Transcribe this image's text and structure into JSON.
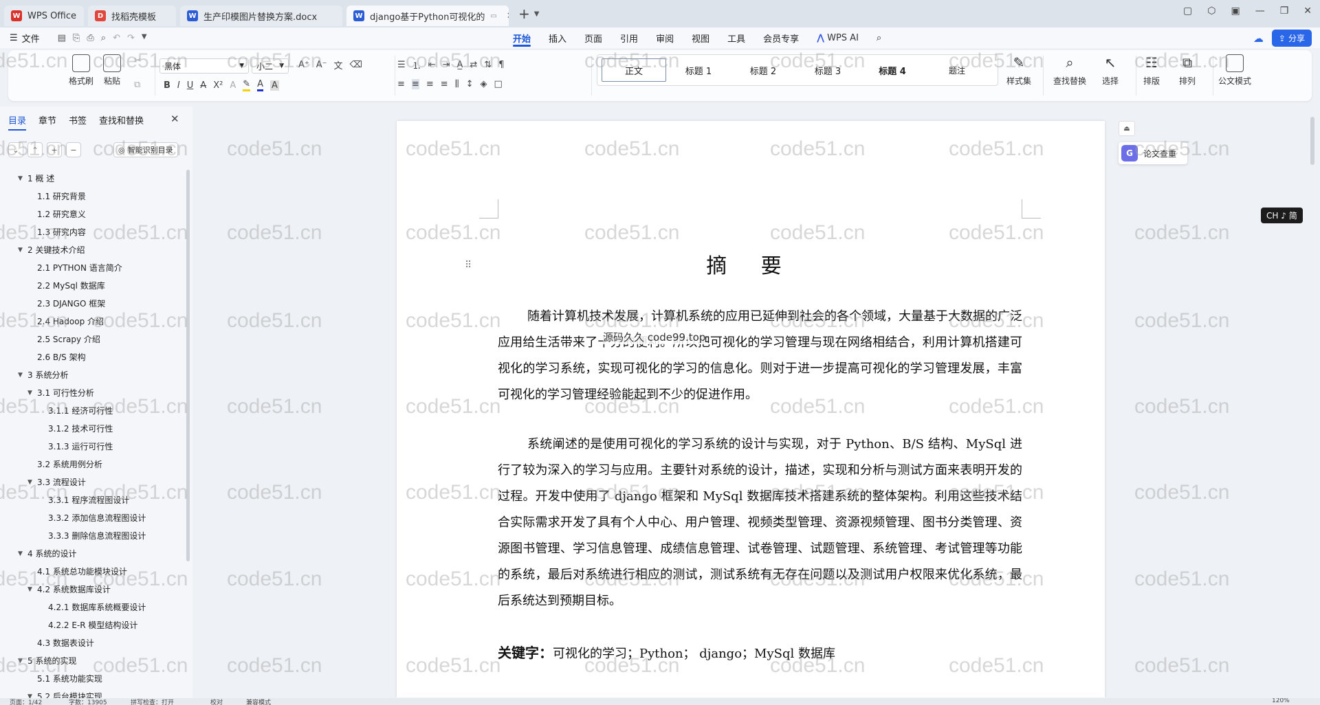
{
  "tabs": [
    {
      "label": "WPS Office",
      "icon": "wps-logo",
      "color": "#d9312a"
    },
    {
      "label": "找稻壳模板",
      "icon": "template-icon",
      "color": "#e0463a"
    },
    {
      "label": "生产印模图片替换方案.docx",
      "icon": "word-doc-icon",
      "color": "#2b5cd6"
    },
    {
      "label": "django基于Python可视化的",
      "icon": "word-doc-icon",
      "color": "#2b5cd6",
      "active": true
    }
  ],
  "menu": {
    "file": "文件",
    "tabs": [
      "开始",
      "插入",
      "页面",
      "引用",
      "审阅",
      "视图",
      "工具",
      "会员专享"
    ],
    "active_tab": "开始",
    "wps_ai": "WPS AI",
    "share": "分享"
  },
  "ribbon": {
    "format_painter": "格式刷",
    "paste": "粘贴",
    "font_name": "黑体",
    "font_size": "小二",
    "styles": [
      "正文",
      "标题 1",
      "标题 2",
      "标题 3",
      "标题 4",
      "题注"
    ],
    "style_set": "样式集",
    "find_replace": "查找替换",
    "select": "选择",
    "layout": "排版",
    "arrange": "排列",
    "official_mode": "公文模式"
  },
  "nav": {
    "tabs": [
      "目录",
      "章节",
      "书签",
      "查找和替换"
    ],
    "active_tab": "目录",
    "smart_btn": "智能识别目录",
    "toc": [
      {
        "level": 0,
        "text": "1   概    述",
        "expand": true
      },
      {
        "level": 1,
        "text": "1.1  研究背景"
      },
      {
        "level": 1,
        "text": "1.2  研究意义"
      },
      {
        "level": 1,
        "text": "1.3  研究内容"
      },
      {
        "level": 0,
        "text": "2   关键技术介绍",
        "expand": true
      },
      {
        "level": 1,
        "text": "2.1 PYTHON 语言简介"
      },
      {
        "level": 1,
        "text": "2.2 MySql 数据库"
      },
      {
        "level": 1,
        "text": "2.3 DJANGO 框架"
      },
      {
        "level": 1,
        "text": "2.4 Hadoop 介绍"
      },
      {
        "level": 1,
        "text": "2.5 Scrapy 介绍"
      },
      {
        "level": 1,
        "text": "2.6 B/S 架构"
      },
      {
        "level": 0,
        "text": "3   系统分析",
        "expand": true
      },
      {
        "level": 1,
        "text": "3.1   可行性分析",
        "expand": true
      },
      {
        "level": 2,
        "text": "3.1.1 经济可行性"
      },
      {
        "level": 2,
        "text": "3.1.2 技术可行性"
      },
      {
        "level": 2,
        "text": "3.1.3 运行可行性"
      },
      {
        "level": 1,
        "text": "3.2 系统用例分析"
      },
      {
        "level": 1,
        "text": "3.3 流程设计",
        "expand": true
      },
      {
        "level": 2,
        "text": "3.3.1 程序流程图设计"
      },
      {
        "level": 2,
        "text": "3.3.2 添加信息流程图设计"
      },
      {
        "level": 2,
        "text": "3.3.3 删除信息流程图设计"
      },
      {
        "level": 0,
        "text": "4   系统的设计",
        "expand": true
      },
      {
        "level": 1,
        "text": "4.1  系统总功能模块设计"
      },
      {
        "level": 1,
        "text": "4.2  系统数据库设计",
        "expand": true
      },
      {
        "level": 2,
        "text": "4.2.1  数据库系统概要设计"
      },
      {
        "level": 2,
        "text": "4.2.2 E-R 模型结构设计"
      },
      {
        "level": 1,
        "text": "4.3 数据表设计"
      },
      {
        "level": 0,
        "text": "5   系统的实现",
        "expand": true
      },
      {
        "level": 1,
        "text": "5.1 系统功能实现"
      },
      {
        "level": 1,
        "text": "5.2 后台模块实现",
        "expand": true
      }
    ]
  },
  "doc": {
    "title": "摘 要",
    "para1": "随着计算机技术发展，计算机系统的应用已延伸到社会的各个领域，大量基于大数据的广泛应用给生活带来了十分的便利。所以把可视化的学习管理与现在网络相结合，利用计算机搭建可视化的学习系统，实现可视化的学习的信息化。则对于进一步提高可视化的学习管理发展，丰富可视化的学习管理经验能起到不少的促进作用。",
    "para2": "系统阐述的是使用可视化的学习系统的设计与实现，对于 Python、B/S 结构、MySql 进行了较为深入的学习与应用。主要针对系统的设计，描述，实现和分析与测试方面来表明开发的过程。开发中使用了 django 框架和 MySql 数据库技术搭建系统的整体架构。利用这些技术结合实际需求开发了具有个人中心、用户管理、视频类型管理、资源视频管理、图书分类管理、资源图书管理、学习信息管理、成绩信息管理、试卷管理、试题管理、系统管理、考试管理等功能的系统，最后对系统进行相应的测试，测试系统有无存在问题以及测试用户权限来优化系统，最后系统达到预期目标。",
    "keywords_label": "关键字：",
    "keywords": "可视化的学习；Python； django；MySql 数据库",
    "overlay": "源码久久 code99.top"
  },
  "side": {
    "plagiarism": "论文查重",
    "ime": "CH ♪ 简"
  },
  "status": {
    "page": "页面：1/42",
    "words": "字数：13905",
    "spell": "拼写检查：打开",
    "proof": "校对",
    "compat": "兼容模式",
    "zoom": "120%"
  },
  "watermark": "code51.cn"
}
